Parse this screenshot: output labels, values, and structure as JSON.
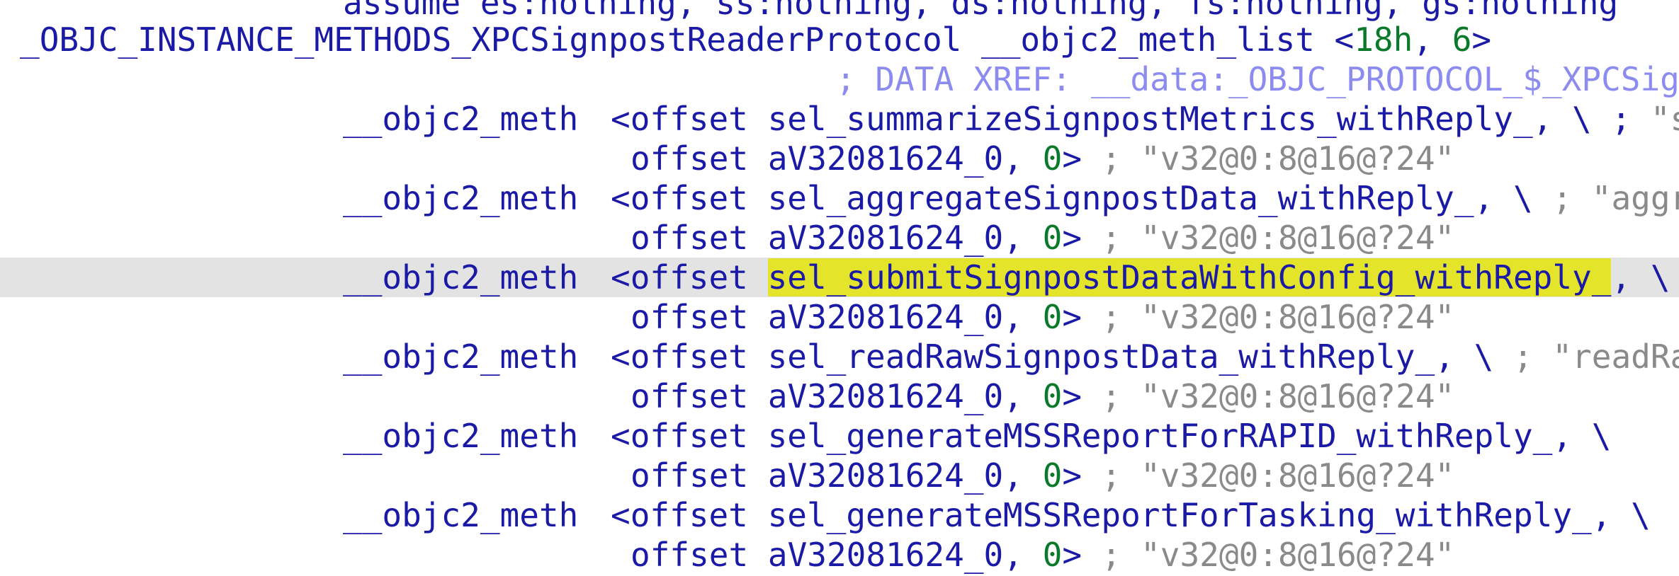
{
  "lines": {
    "l0": {
      "text": "assume es:nothing, ss:nothing, ds:nothing, fs:nothing, gs:nothing"
    },
    "l1": {
      "label": "_OBJC_INSTANCE_METHODS_XPCSignpostReaderProtocol",
      "directive": "__objc2_meth_list <",
      "n1": "18h",
      "sep": ", ",
      "n2": "6",
      "close": ">"
    },
    "l2": {
      "comment": "; DATA XREF: __data:_OBJC_PROTOCOL_$_XPCSignpostReaderProtocol"
    },
    "l3": {
      "meth": "__objc2_meth",
      "offset": "<offset",
      "sym": "sel_summarizeSignpostMetrics_withReply_",
      "tail": ", \\ ;",
      "cmt": " \"summarizeSignpostMetrics:withReply:\""
    },
    "l4": {
      "offset": "offset",
      "sym": "aV32081624_0",
      "comma": ", ",
      "zero": "0",
      "close": ">",
      "cmt": " ; \"v32@0:8@16@?24\""
    },
    "l5": {
      "meth": "__objc2_meth",
      "offset": "<offset",
      "sym": "sel_aggregateSignpostData_withReply_",
      "tail": ", \\",
      "cmt": " ; \"aggregateSignpostData:withReply:\""
    },
    "l6": {
      "offset": "offset",
      "sym": "aV32081624_0",
      "comma": ", ",
      "zero": "0",
      "close": ">",
      "cmt": " ; \"v32@0:8@16@?24\""
    },
    "l7": {
      "meth": "__objc2_meth",
      "offset": "<offset",
      "sym": "sel_submitSignpostDataWithConfig_withReply_",
      "tail": ", \\"
    },
    "l8": {
      "offset": "offset",
      "sym": "aV32081624_0",
      "comma": ", ",
      "zero": "0",
      "close": ">",
      "cmt": " ; \"v32@0:8@16@?24\""
    },
    "l9": {
      "meth": "__objc2_meth",
      "offset": "<offset",
      "sym": "sel_readRawSignpostData_withReply_",
      "tail": ", \\",
      "cmt": " ; \"readRawSignpostData:withReply:\""
    },
    "l10": {
      "offset": "offset",
      "sym": "aV32081624_0",
      "comma": ", ",
      "zero": "0",
      "close": ">",
      "cmt": " ; \"v32@0:8@16@?24\""
    },
    "l11": {
      "meth": "__objc2_meth",
      "offset": "<offset",
      "sym": "sel_generateMSSReportForRAPID_withReply_",
      "tail": ", \\"
    },
    "l12": {
      "offset": "offset",
      "sym": "aV32081624_0",
      "comma": ", ",
      "zero": "0",
      "close": ">",
      "cmt": " ; \"v32@0:8@16@?24\""
    },
    "l13": {
      "meth": "__objc2_meth",
      "offset": "<offset",
      "sym": "sel_generateMSSReportForTasking_withReply_",
      "tail": ", \\"
    },
    "l14": {
      "offset": "offset",
      "sym": "aV32081624_0",
      "comma": ", ",
      "zero": "0",
      "close": ">",
      "cmt": " ; \"v32@0:8@16@?24\""
    }
  },
  "colors": {
    "keyword": "#1a1aa6",
    "number": "#0a7a2a",
    "comment": "#8a8a8a",
    "xref": "#8c8cf0",
    "highlight": "#e4e42a",
    "row_highlight": "#e3e3e3"
  }
}
